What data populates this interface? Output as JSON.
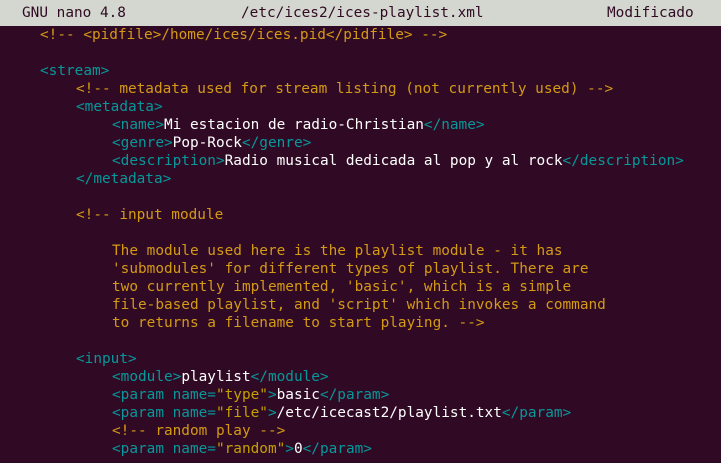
{
  "titlebar": {
    "app": "GNU nano 4.8",
    "file": "/etc/ices2/ices-playlist.xml",
    "status": "Modificado"
  },
  "lines": [
    {
      "indent": 1,
      "segs": [
        {
          "c": "c",
          "t": "<!-- <pidfile>/home/ices/ices.pid</pidfile> -->"
        }
      ]
    },
    {
      "indent": 0,
      "segs": []
    },
    {
      "indent": 1,
      "segs": [
        {
          "c": "t",
          "t": "<stream>"
        }
      ]
    },
    {
      "indent": 2,
      "segs": [
        {
          "c": "c",
          "t": "<!-- metadata used for stream listing (not currently used) -->"
        }
      ]
    },
    {
      "indent": 2,
      "segs": [
        {
          "c": "t",
          "t": "<metadata>"
        }
      ]
    },
    {
      "indent": 3,
      "segs": [
        {
          "c": "t",
          "t": "<name>"
        },
        {
          "c": "w",
          "t": "Mi estacion de radio-Christian"
        },
        {
          "c": "t",
          "t": "</name>"
        }
      ]
    },
    {
      "indent": 3,
      "segs": [
        {
          "c": "t",
          "t": "<genre>"
        },
        {
          "c": "w",
          "t": "Pop-Rock"
        },
        {
          "c": "t",
          "t": "</genre>"
        }
      ]
    },
    {
      "indent": 3,
      "segs": [
        {
          "c": "t",
          "t": "<description>"
        },
        {
          "c": "w",
          "t": "Radio musical dedicada al pop y al rock"
        },
        {
          "c": "t",
          "t": "</description>"
        }
      ]
    },
    {
      "indent": 2,
      "segs": [
        {
          "c": "t",
          "t": "</metadata>"
        }
      ]
    },
    {
      "indent": 0,
      "segs": []
    },
    {
      "indent": 2,
      "segs": [
        {
          "c": "c",
          "t": "<!-- input module"
        }
      ]
    },
    {
      "indent": 0,
      "segs": []
    },
    {
      "indent": 3,
      "segs": [
        {
          "c": "c",
          "t": "The module used here is the playlist module - it has"
        }
      ]
    },
    {
      "indent": 3,
      "segs": [
        {
          "c": "c",
          "t": "'submodules' for different types of playlist. There are"
        }
      ]
    },
    {
      "indent": 3,
      "segs": [
        {
          "c": "c",
          "t": "two currently implemented, 'basic', which is a simple"
        }
      ]
    },
    {
      "indent": 3,
      "segs": [
        {
          "c": "c",
          "t": "file-based playlist, and 'script' which invokes a command"
        }
      ]
    },
    {
      "indent": 3,
      "segs": [
        {
          "c": "c",
          "t": "to returns a filename to start playing. -->"
        }
      ]
    },
    {
      "indent": 0,
      "segs": []
    },
    {
      "indent": 2,
      "segs": [
        {
          "c": "t",
          "t": "<input>"
        }
      ]
    },
    {
      "indent": 3,
      "segs": [
        {
          "c": "t",
          "t": "<module>"
        },
        {
          "c": "w",
          "t": "playlist"
        },
        {
          "c": "t",
          "t": "</module>"
        }
      ]
    },
    {
      "indent": 3,
      "segs": [
        {
          "c": "t",
          "t": "<param name="
        },
        {
          "c": "a",
          "t": "\"type\""
        },
        {
          "c": "t",
          "t": ">"
        },
        {
          "c": "w",
          "t": "basic"
        },
        {
          "c": "t",
          "t": "</param>"
        }
      ]
    },
    {
      "indent": 3,
      "segs": [
        {
          "c": "t",
          "t": "<param name="
        },
        {
          "c": "a",
          "t": "\"file\""
        },
        {
          "c": "t",
          "t": ">"
        },
        {
          "c": "w",
          "t": "/etc/icecast2/playlist.txt"
        },
        {
          "c": "t",
          "t": "</param>"
        }
      ]
    },
    {
      "indent": 3,
      "segs": [
        {
          "c": "c",
          "t": "<!-- random play -->"
        }
      ]
    },
    {
      "indent": 3,
      "segs": [
        {
          "c": "t",
          "t": "<param name="
        },
        {
          "c": "a",
          "t": "\"random\""
        },
        {
          "c": "t",
          "t": ">"
        },
        {
          "c": "w",
          "t": "0"
        },
        {
          "c": "t",
          "t": "</param>"
        }
      ]
    }
  ]
}
